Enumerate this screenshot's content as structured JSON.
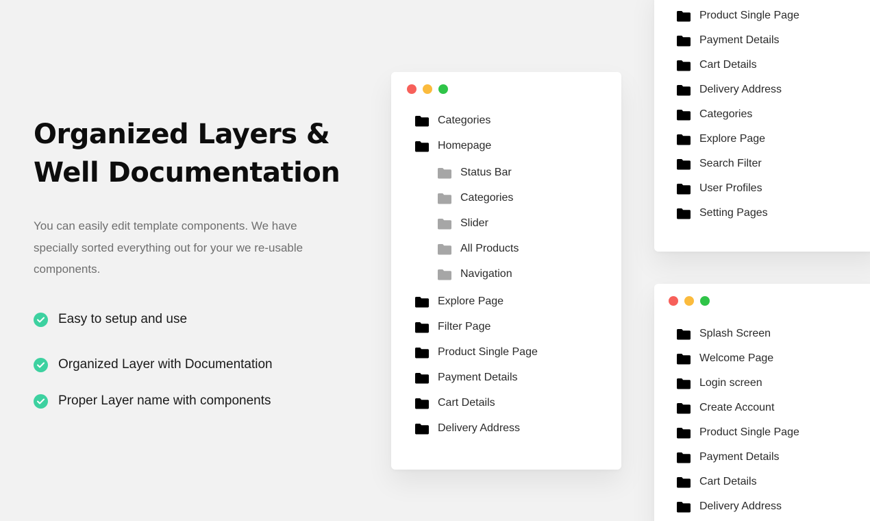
{
  "left": {
    "title_line1": "Organized Layers &",
    "title_line2": "Well Documentation",
    "description": "You can easily edit template components. We have specially sorted everything out for your we re-usable components.",
    "features": [
      "Easy to setup and use",
      "Organized Layer with Documentation",
      "Proper Layer name with components"
    ]
  },
  "center_window": {
    "items": [
      {
        "label": "Categories",
        "level": 0
      },
      {
        "label": "Homepage",
        "level": 0
      },
      {
        "label": "Status Bar",
        "level": 1
      },
      {
        "label": "Categories",
        "level": 1
      },
      {
        "label": "Slider",
        "level": 1
      },
      {
        "label": "All Products",
        "level": 1
      },
      {
        "label": "Navigation",
        "level": 1
      },
      {
        "label": "Explore Page",
        "level": 0
      },
      {
        "label": "Filter Page",
        "level": 0
      },
      {
        "label": "Product Single Page",
        "level": 0
      },
      {
        "label": "Payment Details",
        "level": 0
      },
      {
        "label": "Cart Details",
        "level": 0
      },
      {
        "label": "Delivery Address",
        "level": 0
      }
    ]
  },
  "top_right_window": {
    "items": [
      "Product Single Page",
      "Payment Details",
      "Cart Details",
      "Delivery Address",
      "Categories",
      "Explore Page",
      "Search Filter",
      "User Profiles",
      "Setting Pages"
    ]
  },
  "bottom_right_window": {
    "items": [
      "Splash Screen",
      "Welcome Page",
      "Login screen",
      "Create Account",
      "Product Single Page",
      "Payment Details",
      "Cart Details",
      "Delivery Address"
    ]
  },
  "colors": {
    "background": "#f2f2f2",
    "check": "#3dd1a0",
    "folder_primary": "#000000",
    "folder_sub": "#a6a6a6",
    "dot_red": "#f7605a",
    "dot_yellow": "#fbbb3d",
    "dot_green": "#2fc448"
  }
}
